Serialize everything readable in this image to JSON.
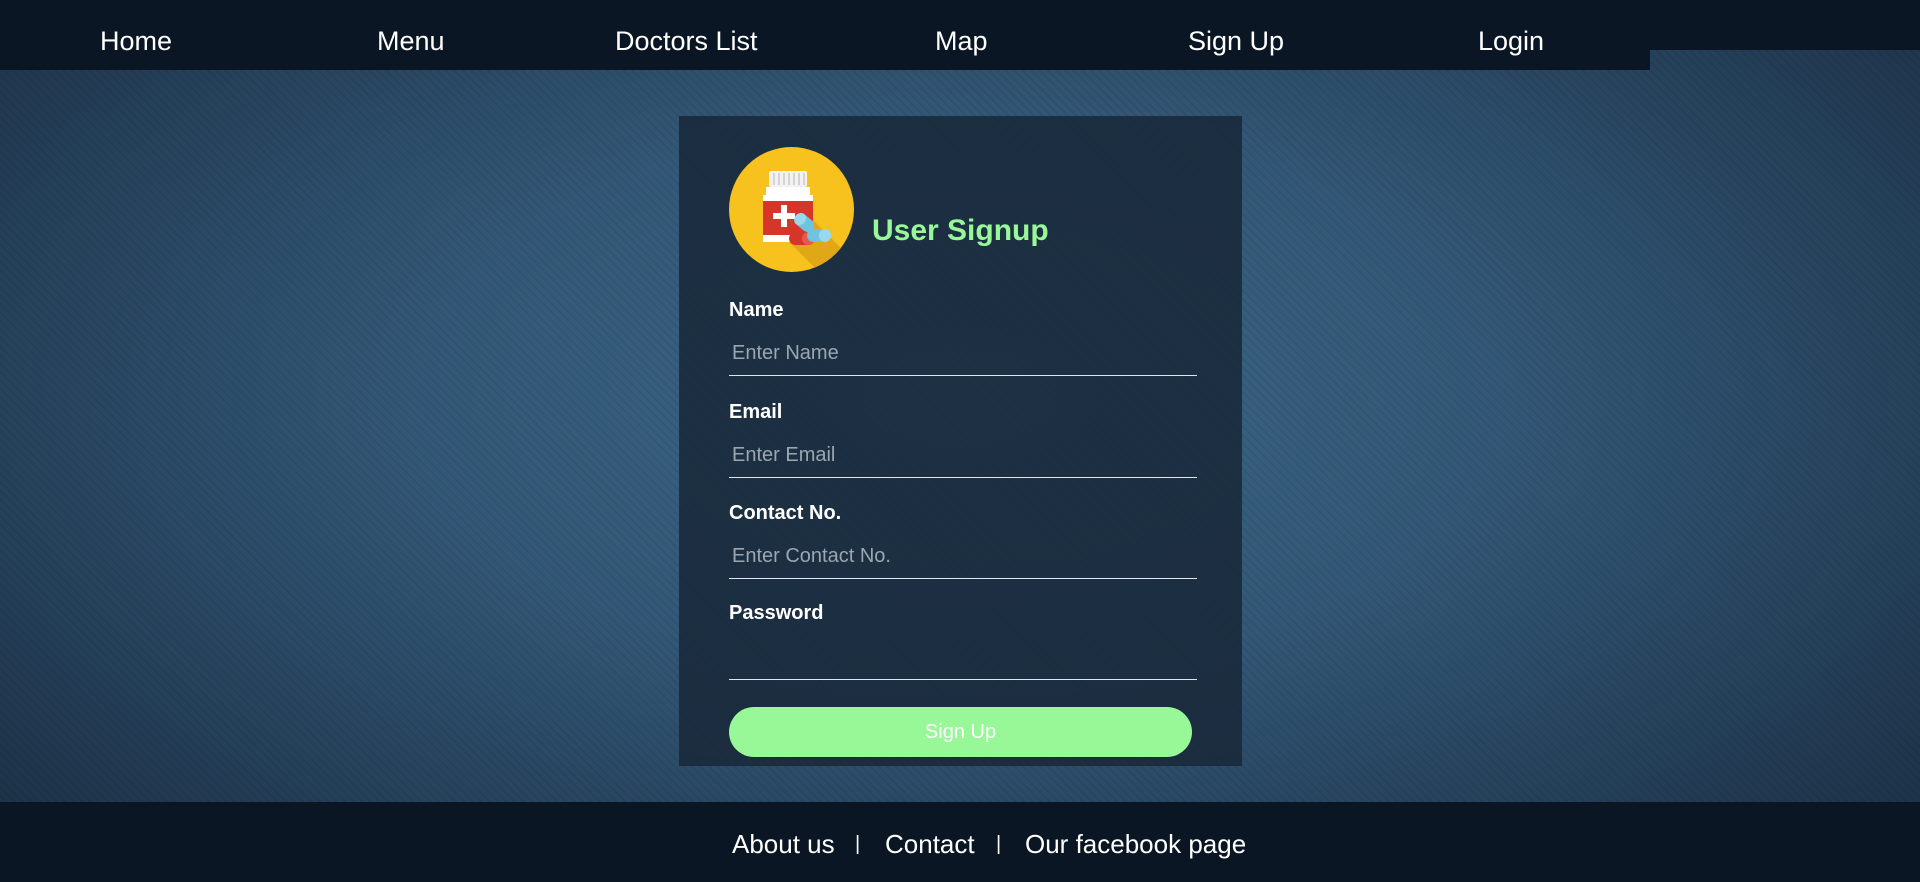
{
  "nav": {
    "items": [
      {
        "label": "Home"
      },
      {
        "label": "Menu"
      },
      {
        "label": "Doctors List"
      },
      {
        "label": "Map"
      },
      {
        "label": "Sign Up"
      },
      {
        "label": "Login"
      }
    ]
  },
  "card": {
    "title": "User Signup",
    "logo_icon": "medicine-bottle-icon",
    "fields": {
      "name": {
        "label": "Name",
        "placeholder": "Enter Name",
        "value": ""
      },
      "email": {
        "label": "Email",
        "placeholder": "Enter Email",
        "value": ""
      },
      "contact": {
        "label": "Contact No.",
        "placeholder": "Enter Contact No.",
        "value": ""
      },
      "password": {
        "label": "Password",
        "placeholder": "",
        "value": ""
      }
    },
    "submit_label": "Sign Up"
  },
  "footer": {
    "links": [
      {
        "label": "About us"
      },
      {
        "label": "Contact"
      },
      {
        "label": "Our facebook page"
      }
    ],
    "separator": "|"
  },
  "colors": {
    "bar_bg": "#0a1623",
    "accent_green": "#98f898",
    "logo_yellow": "#f7c21e",
    "card_bg": "#172636"
  }
}
